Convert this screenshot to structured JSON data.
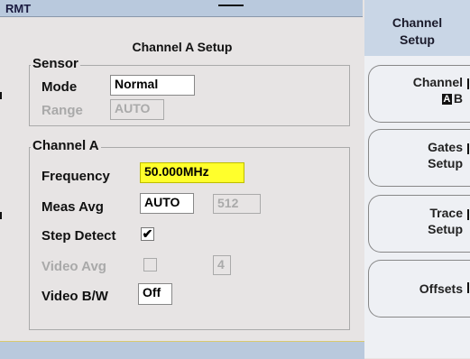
{
  "status": {
    "label": "RMT"
  },
  "page": {
    "title": "Channel A Setup"
  },
  "sensor": {
    "legend": "Sensor",
    "mode_label": "Mode",
    "mode_value": "Normal",
    "range_label": "Range",
    "range_value": "AUTO"
  },
  "channel": {
    "legend": "Channel A",
    "frequency_label": "Frequency",
    "frequency_value": "50.000MHz",
    "meas_avg_label": "Meas Avg",
    "meas_avg_value": "AUTO",
    "meas_avg_count": "512",
    "step_detect_label": "Step Detect",
    "step_detect_checked": "✔",
    "video_avg_label": "Video Avg",
    "video_avg_count": "4",
    "video_bw_label": "Video B/W",
    "video_bw_value": "Off"
  },
  "menu": {
    "title_line1": "Channel",
    "title_line2": "Setup",
    "softkeys": [
      {
        "line1": "Channel",
        "box": "A",
        "line2": "B"
      },
      {
        "line1": "Gates",
        "line2": "Setup"
      },
      {
        "line1": "Trace",
        "line2": "Setup"
      },
      {
        "line1": "Offsets"
      }
    ]
  },
  "colors": {
    "highlight": "#ffff2c",
    "title_bar": "#b9c9dd",
    "panel": "#e7e4e4"
  }
}
